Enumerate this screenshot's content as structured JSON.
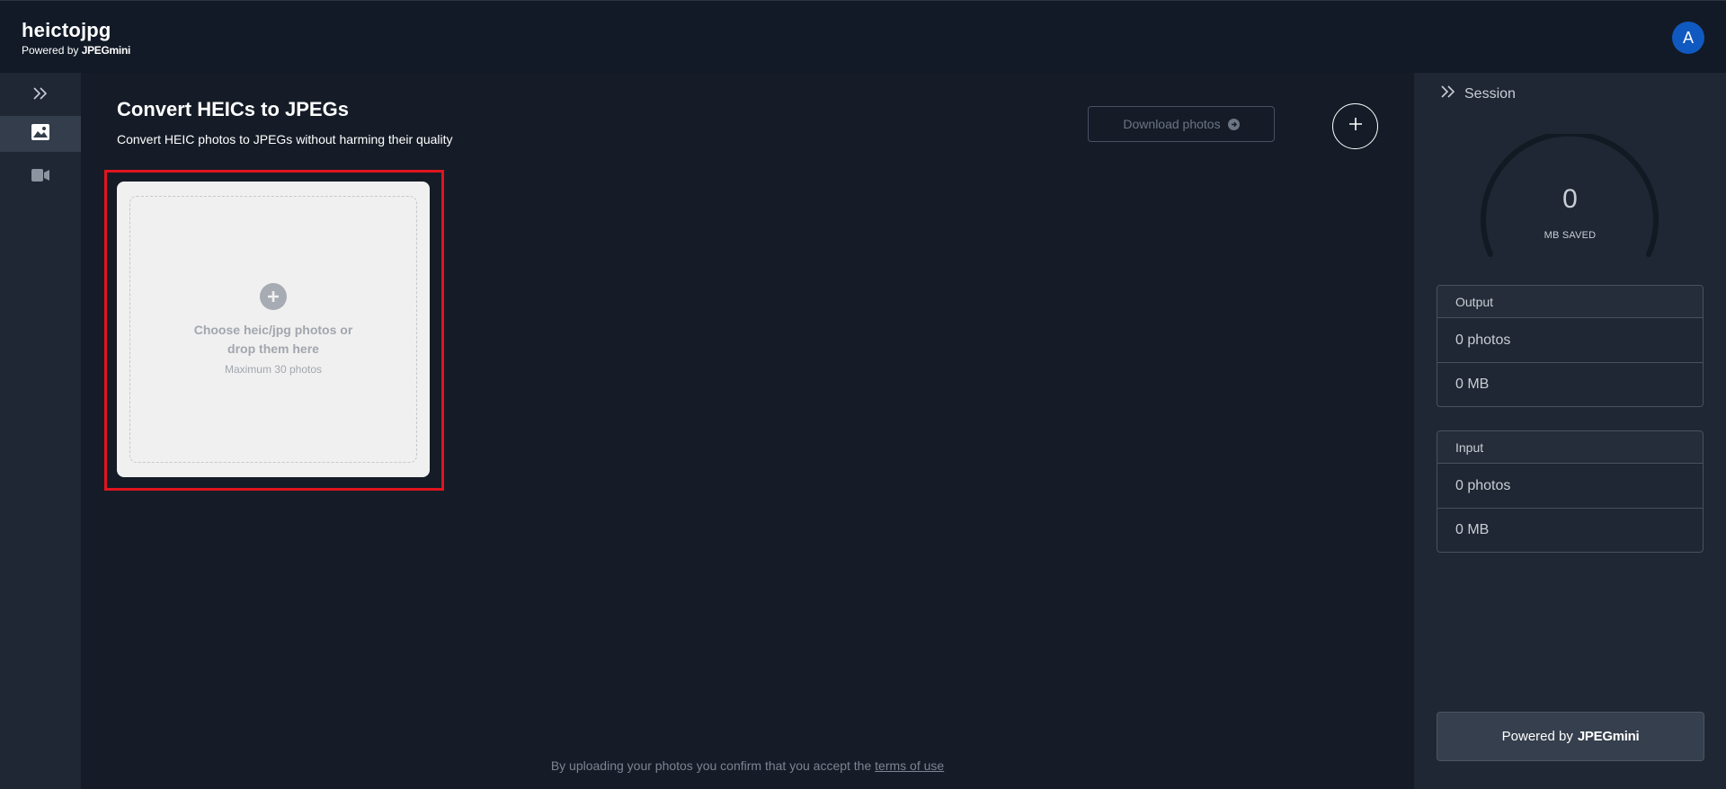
{
  "app": {
    "name": "heictojpg",
    "powered_by_prefix": "Powered by",
    "powered_by_brand": "JPEGmini",
    "avatar_letter": "A"
  },
  "nav": {
    "items": [
      {
        "icon": "image-icon",
        "active": true
      },
      {
        "icon": "video-icon",
        "active": false
      }
    ]
  },
  "main": {
    "title": "Convert HEICs to JPEGs",
    "subtitle": "Convert HEIC photos to JPEGs without harming their quality",
    "download_label": "Download photos",
    "dropzone": {
      "text": "Choose heic/jpg photos or drop them here",
      "subtext": "Maximum 30 photos"
    },
    "footer": {
      "text": "By uploading your photos you confirm that you accept the",
      "link": "terms of use"
    }
  },
  "session": {
    "title": "Session",
    "saved_value": "0",
    "saved_label": "MB SAVED",
    "output": {
      "label": "Output",
      "photos": "0 photos",
      "size": "0 MB"
    },
    "input": {
      "label": "Input",
      "photos": "0 photos",
      "size": "0 MB"
    },
    "powered_prefix": "Powered by",
    "powered_brand": "JPEGmini"
  },
  "colors": {
    "background": "#151c27",
    "topbar": "#111a26",
    "panel": "#1e2733",
    "accent_avatar": "#1059c0",
    "highlight": "#e0141e"
  }
}
